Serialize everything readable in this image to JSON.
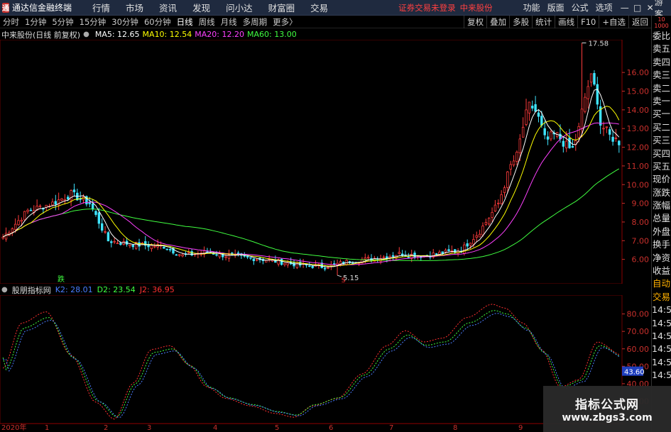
{
  "app": {
    "title": "通达信金融终端",
    "logo_text": "通",
    "guest": "游客"
  },
  "menu": [
    "行情",
    "市场",
    "资讯",
    "发现",
    "问小达",
    "财富圈",
    "交易"
  ],
  "status_warning": "证券交易未登录",
  "status_stock": "中来股份",
  "right_menu": [
    "功能",
    "版面",
    "公式",
    "选项"
  ],
  "window_controls": [
    "—",
    "□",
    "✕"
  ],
  "periods": [
    "分时",
    "1分钟",
    "5分钟",
    "15分钟",
    "30分钟",
    "60分钟",
    "日线",
    "周线",
    "月线",
    "多周期",
    "更多〉"
  ],
  "active_period": "日线",
  "toolbar": [
    "复权",
    "叠加",
    "多股",
    "统计",
    "画线",
    "F10",
    "+自选",
    "返回"
  ],
  "side_items": [
    "委比",
    "卖五",
    "卖四",
    "卖三",
    "卖二",
    "卖一",
    "买一",
    "买二",
    "买三",
    "买四",
    "买五",
    "现价",
    "涨跌",
    "涨幅",
    "总量",
    "外盘",
    "换手",
    "净资",
    "收益",
    "自动",
    "交易",
    "14:56",
    "14:56",
    "14:56",
    "14:56",
    "14:56",
    "14:56"
  ],
  "side_mini": "10\n1000",
  "info": {
    "stock": "中来股份(日线 前复权)",
    "ma5": "MA5: 12.65",
    "ma10": "MA10: 12.54",
    "ma20": "MA20: 12.20",
    "ma60": "MA60: 13.00",
    "colors": {
      "ma5": "#ffffff",
      "ma10": "#ffff00",
      "ma20": "#ff40ff",
      "ma60": "#40ff40"
    }
  },
  "kdj": {
    "name": "股朋指标网",
    "k": "K2: 28.01",
    "d": "D2: 23.54",
    "j": "J2: 36.95",
    "colors": {
      "k": "#4a7dff",
      "d": "#40ff40",
      "j": "#ff3030"
    }
  },
  "price_axis": [
    "16.00",
    "15.00",
    "14.00",
    "13.00",
    "12.00",
    "11.00",
    "10.00",
    "9.00",
    "8.00",
    "7.00",
    "6.00"
  ],
  "ind_axis": [
    "80.00",
    "70.00",
    "60.00",
    "50.00",
    "40.00",
    "30.00"
  ],
  "ind_tag": "43.60",
  "annotations": {
    "high": "17.58",
    "low": "5.15",
    "down_mark": "跌",
    "s_mark": "S"
  },
  "time_labels": [
    "2020年",
    "1",
    "2",
    "3",
    "4",
    "5",
    "6",
    "7",
    "8",
    "9"
  ],
  "watermark": {
    "line1": "指标公式网",
    "line2": "www.zbgs3.com"
  },
  "chart_data": {
    "type": "candlestick",
    "series": [
      {
        "name": "MA5"
      },
      {
        "name": "MA10"
      },
      {
        "name": "MA20"
      },
      {
        "name": "MA60"
      }
    ],
    "indicator": {
      "type": "line",
      "series": [
        {
          "name": "K2"
        },
        {
          "name": "D2"
        },
        {
          "name": "J2"
        }
      ]
    },
    "ylim": [
      5,
      17.6
    ],
    "ind_ylim": [
      18,
      90
    ]
  }
}
